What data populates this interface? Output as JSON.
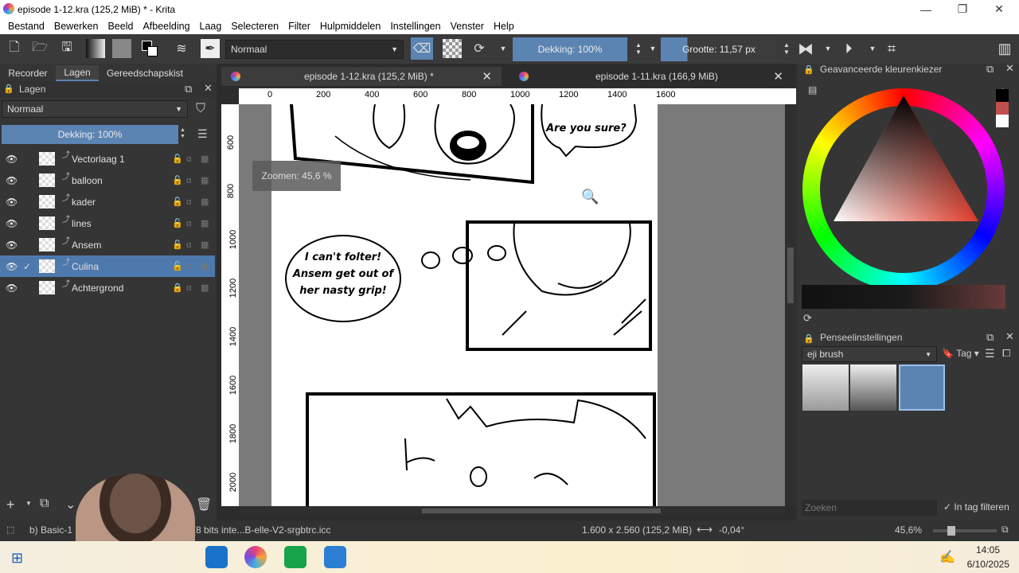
{
  "window": {
    "title": "episode 1-12.kra (125,2 MiB) * - Krita"
  },
  "menu": [
    "Bestand",
    "Bewerken",
    "Beeld",
    "Afbeelding",
    "Laag",
    "Selecteren",
    "Filter",
    "Hulpmiddelen",
    "Instellingen",
    "Venster",
    "Help"
  ],
  "toolbar": {
    "blend_mode": "Normaal",
    "opacity": "Dekking: 100%",
    "size": "Grootte: 11,57 px"
  },
  "left_panel": {
    "tabs": [
      "Recorder",
      "Lagen",
      "Gereedschapskist"
    ],
    "active_tab": "Lagen",
    "title": "Lagen",
    "blend_mode": "Normaal",
    "opacity": "Dekking:  100%",
    "layers": [
      {
        "name": "Vectorlaag 1",
        "visible": true
      },
      {
        "name": "balloon",
        "visible": true
      },
      {
        "name": "kader",
        "visible": true
      },
      {
        "name": "lines",
        "visible": true
      },
      {
        "name": "Ansem",
        "visible": true
      },
      {
        "name": "Culina",
        "visible": true,
        "selected": true,
        "check": "✓"
      },
      {
        "name": "Achtergrond",
        "visible": true,
        "locked": true
      }
    ]
  },
  "documents": {
    "tabs": [
      {
        "label": "episode 1-12.kra (125,2 MiB) *"
      },
      {
        "label": "episode 1-11.kra (166,9 MiB)"
      }
    ]
  },
  "canvas": {
    "zoom_tooltip": "Zoomen: 45,6 %",
    "ruler_top": [
      "0",
      "200",
      "400",
      "600",
      "800",
      "1000",
      "1200",
      "1400",
      "1600"
    ],
    "ruler_left": [
      "600",
      "800",
      "1000",
      "1200",
      "1400",
      "1600",
      "1800",
      "2000"
    ],
    "balloon1": "Are you sure?",
    "balloon2": [
      "I can't folter!",
      "Ansem get out of",
      "her nasty grip!"
    ]
  },
  "right_panel": {
    "color_title": "Geavanceerde kleurenkiezer",
    "brush_title": "Penseelinstellingen",
    "brush_tag": "eji brush",
    "tag_btn": "Tag",
    "search_placeholder": "Zoeken",
    "filter_label": "In tag filteren"
  },
  "status": {
    "tool": "b) Basic-1",
    "colorspace": "a (8 bits inte...B-elle-V2-srgbtrc.icc",
    "dimensions": "1.600 x 2.560 (125,2 MiB)",
    "rotation": "-0,04°",
    "zoom": "45,6%"
  },
  "taskbar": {
    "time": "14:05",
    "date": "6/10/2025"
  },
  "colors": {
    "accent": "#5b84b3",
    "panel": "#353535",
    "selected_layer": "#4e79ad"
  }
}
